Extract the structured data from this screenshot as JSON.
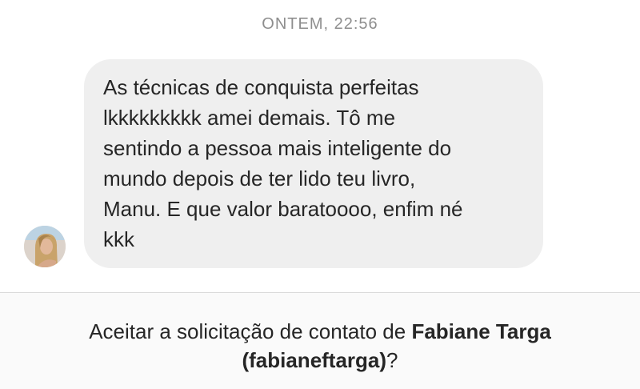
{
  "timestamp": "ONTEM, 22:56",
  "message": {
    "text": "As técnicas de conquista perfeitas\nlkkkkkkkkk amei demais. Tô me\nsentindo a pessoa mais inteligente do\nmundo depois de ter lido teu livro,\nManu. E que valor baratoooo, enfim né\nkkk",
    "avatar_icon": "user-avatar"
  },
  "request": {
    "prefix": "Aceitar a solicitação de contato de ",
    "name": "Fabiane Targa",
    "handle": "(fabianeftarga)",
    "suffix": "?"
  },
  "colors": {
    "bubble_bg": "#efefef",
    "timestamp": "#8e8e8e",
    "text": "#262626",
    "bar_bg": "#fafafa"
  }
}
